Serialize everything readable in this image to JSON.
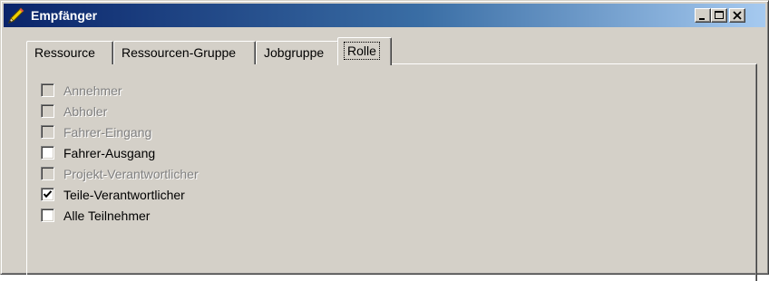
{
  "window": {
    "title": "Empfänger",
    "title_icon": "pencil-icon",
    "controls": {
      "minimize": "minimize-icon",
      "maximize": "maximize-icon",
      "close": "close-icon"
    }
  },
  "tabs": [
    {
      "label": "Ressource",
      "active": false
    },
    {
      "label": "Ressourcen-Gruppe",
      "active": false
    },
    {
      "label": "Jobgruppe",
      "active": false
    },
    {
      "label": "Rolle",
      "active": true
    }
  ],
  "checkboxes": [
    {
      "label": "Annehmer",
      "checked": false,
      "enabled": false
    },
    {
      "label": "Abholer",
      "checked": false,
      "enabled": false
    },
    {
      "label": "Fahrer-Eingang",
      "checked": false,
      "enabled": false
    },
    {
      "label": "Fahrer-Ausgang",
      "checked": false,
      "enabled": true
    },
    {
      "label": "Projekt-Verantwortlicher",
      "checked": false,
      "enabled": false
    },
    {
      "label": "Teile-Verantwortlicher",
      "checked": true,
      "enabled": true
    },
    {
      "label": "Alle Teilnehmer",
      "checked": false,
      "enabled": true
    }
  ],
  "colors": {
    "face": "#d4d0c8",
    "title_gradient_start": "#0a246a",
    "title_gradient_end": "#a6caf0",
    "disabled_text": "#808080"
  }
}
